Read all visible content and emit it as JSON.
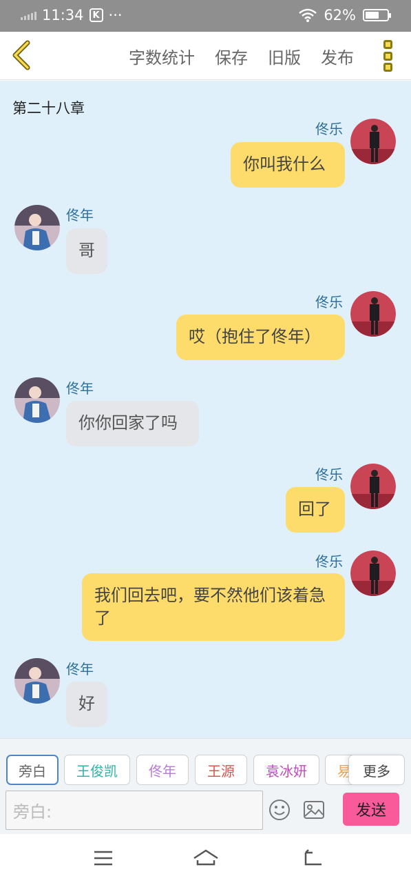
{
  "status_bar": {
    "time": "11:34",
    "k_badge": "K",
    "dots": "···",
    "battery": "62%",
    "battery_level": 0.62
  },
  "toolbar": {
    "word_count": "字数统计",
    "save": "保存",
    "old_version": "旧版",
    "publish": "发布"
  },
  "chapter_title": "第二十八章",
  "messages": [
    {
      "from": "me",
      "name": "佟乐",
      "text": "你叫我什么"
    },
    {
      "from": "other",
      "name": "佟年",
      "text": "哥"
    },
    {
      "from": "me",
      "name": "佟乐",
      "text": "哎（抱住了佟年）"
    },
    {
      "from": "other",
      "name": "佟年",
      "text": "你你回家了吗"
    },
    {
      "from": "me",
      "name": "佟乐",
      "text": "回了"
    },
    {
      "from": "me",
      "name": "佟乐",
      "text": "我们回去吧，要不然他们该着急了"
    },
    {
      "from": "other",
      "name": "佟年",
      "text": "好"
    }
  ],
  "roles": [
    {
      "label": "旁白",
      "color": "#666666"
    },
    {
      "label": "王俊凯",
      "color": "#2fb3a8"
    },
    {
      "label": "佟年",
      "color": "#b77ad8"
    },
    {
      "label": "王源",
      "color": "#d9534f"
    },
    {
      "label": "袁冰妍",
      "color": "#c24bbd"
    },
    {
      "label": "易",
      "color": "#f0a04b"
    }
  ],
  "more_label": "更多",
  "input_placeholder": "旁白:",
  "send_label": "发送",
  "colors": {
    "my_bubble": "#fddc6b",
    "other_bubble": "#e4e6ea",
    "chat_bg": "#dff0fb",
    "send": "#f85a9a",
    "name": "#2c6f9a"
  }
}
